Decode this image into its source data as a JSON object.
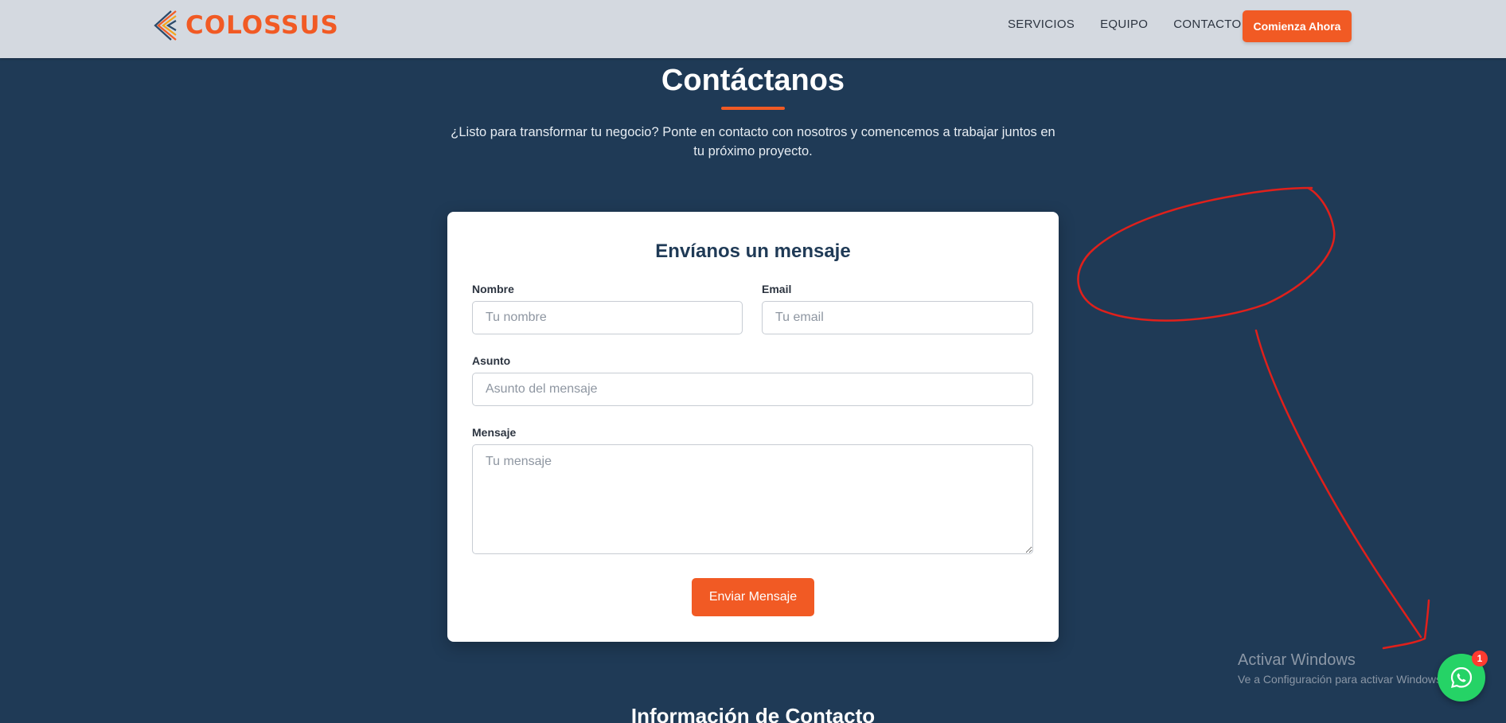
{
  "header": {
    "logo_text": "COLOSSUS",
    "logo_icon": "chevron-lines-logo",
    "nav": [
      {
        "label": "SERVICIOS"
      },
      {
        "label": "EQUIPO"
      },
      {
        "label": "CONTACTO"
      }
    ],
    "cta_label": "Comienza Ahora"
  },
  "hero": {
    "title": "Contáctanos",
    "intro": "¿Listo para transformar tu negocio? Ponte en contacto con nosotros y comencemos a trabajar juntos en tu próximo proyecto."
  },
  "form": {
    "title": "Envíanos un mensaje",
    "name_label": "Nombre",
    "name_placeholder": "Tu nombre",
    "email_label": "Email",
    "email_placeholder": "Tu email",
    "subject_label": "Asunto",
    "subject_placeholder": "Asunto del mensaje",
    "message_label": "Mensaje",
    "message_placeholder": "Tu mensaje",
    "submit_label": "Enviar Mensaje"
  },
  "next_section": {
    "title": "Información de Contacto"
  },
  "windows_watermark": {
    "title": "Activar Windows",
    "subtitle": "Ve a Configuración para activar Windows."
  },
  "whatsapp": {
    "icon": "whatsapp-icon",
    "badge_count": "1"
  },
  "colors": {
    "background": "#1f3a56",
    "header": "#d4d9e0",
    "accent": "#f15a24",
    "annotation": "#e0201b",
    "whatsapp": "#25d366"
  }
}
